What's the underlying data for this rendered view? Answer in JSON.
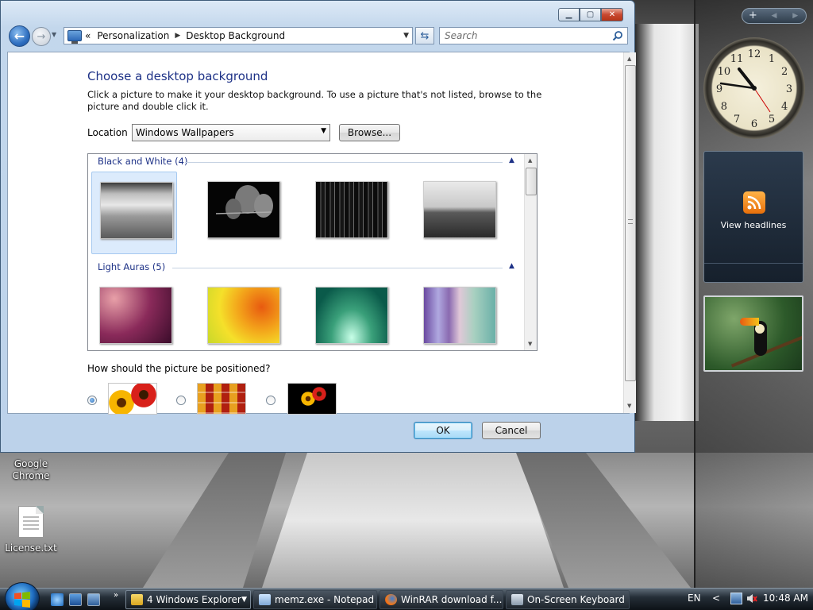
{
  "window": {
    "breadcrumb": [
      "Personalization",
      "Desktop Background"
    ],
    "breadcrumb_root_glyph": "«",
    "search_placeholder": "Search",
    "heading": "Choose a desktop background",
    "description": "Click a picture to make it your desktop background. To use a picture that's not listed, browse to the picture and double click it.",
    "location_label": "Location",
    "location_value": "Windows Wallpapers",
    "browse_label": "Browse...",
    "groups": [
      {
        "label": "Black and White (4)",
        "thumbnails": [
          "bw-train-interior",
          "bw-leaf",
          "bw-city-night",
          "bw-tree-lake"
        ]
      },
      {
        "label": "Light Auras (5)",
        "thumbnails": [
          "aura-magenta",
          "aura-yellow-orange",
          "aura-green-teal",
          "aura-vertical-bands"
        ]
      }
    ],
    "position_question": "How should the picture be positioned?",
    "position_options": [
      "fit-to-screen",
      "tile",
      "center"
    ],
    "position_selected": "fit-to-screen",
    "ok_label": "OK",
    "cancel_label": "Cancel"
  },
  "desktop_icons": [
    {
      "label": "Google Chrome",
      "icon": "chrome-icon"
    },
    {
      "label": "License.txt",
      "icon": "text-file-icon"
    }
  ],
  "sidebar": {
    "rss_label": "View headlines",
    "clock_numbers": [
      "12",
      "1",
      "2",
      "3",
      "4",
      "5",
      "6",
      "7",
      "8",
      "9",
      "10",
      "11"
    ]
  },
  "taskbar": {
    "buttons": [
      {
        "label": "4  Windows Explorer",
        "icon": "folder-icon",
        "active": true
      },
      {
        "label": "memz.exe - Notepad",
        "icon": "notepad-icon",
        "active": false
      },
      {
        "label": "WinRAR download f...",
        "icon": "firefox-icon",
        "active": false
      },
      {
        "label": "On-Screen Keyboard",
        "icon": "keyboard-icon",
        "active": false
      }
    ],
    "language": "EN",
    "time": "10:48 AM"
  },
  "colors": {
    "heading": "#1e3287",
    "selection": "#dcebfc",
    "taskbar": "#1e252c"
  }
}
